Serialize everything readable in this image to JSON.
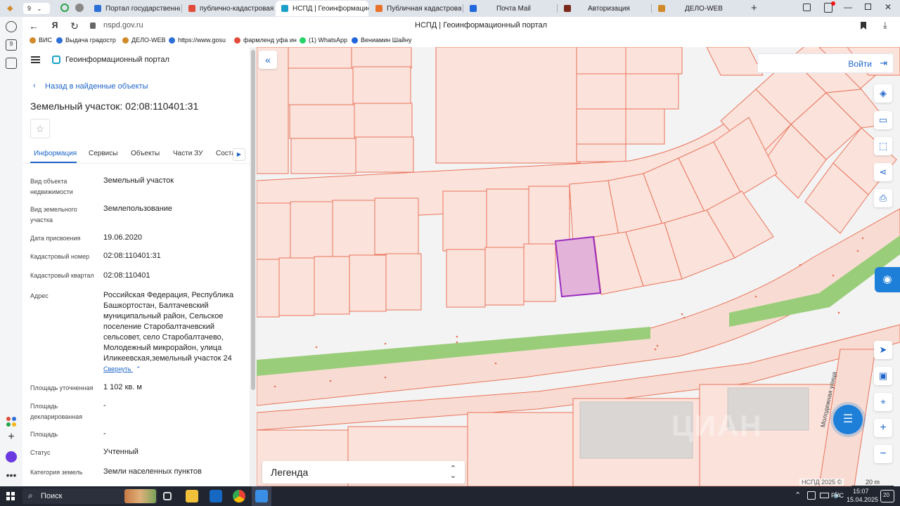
{
  "browser": {
    "tab_count": "9",
    "tabs": [
      {
        "label": "Портал государственных",
        "color": "#2c6fd6"
      },
      {
        "label": "публично-кадастровая ка",
        "color": "#e04b3a"
      },
      {
        "label": "НСПД | Геоинформацио",
        "color": "#1aa0c8"
      },
      {
        "label": "Публичная кадастровая к",
        "color": "#e8722a"
      },
      {
        "label": "Почта Mail",
        "color": "#2266dd"
      },
      {
        "label": "Авторизация",
        "color": "#7a2a1a"
      },
      {
        "label": "ДЕЛО-WEB",
        "color": "#d08a2a"
      }
    ],
    "url": "nspd.gov.ru",
    "page_title": "НСПД | Геоинформационный портал",
    "bookmarks": [
      {
        "label": "ВИС",
        "color": "#d08a2a"
      },
      {
        "label": "Выдача градостр",
        "color": "#2c6fd6"
      },
      {
        "label": "ДЕЛО-WEB",
        "color": "#d08a2a"
      },
      {
        "label": "https://www.gosu",
        "color": "#2c6fd6"
      },
      {
        "label": "фармленд уфа ин",
        "color": "#e04b3a"
      },
      {
        "label": "(1) WhatsApp",
        "color": "#25d366"
      },
      {
        "label": "Вениамин Шайну",
        "color": "#2266dd"
      }
    ]
  },
  "panel": {
    "portal_name": "Геоинформационный портал",
    "back_link": "Назад в найденные объекты",
    "title": "Земельный участок: 02:08:110401:31",
    "tabs": [
      "Информация",
      "Сервисы",
      "Объекты",
      "Части ЗУ",
      "Соста"
    ],
    "fields": [
      {
        "label": "Вид объекта недвижимости",
        "value": "Земельный участок"
      },
      {
        "label": "Вид земельного участка",
        "value": "Землепользование"
      },
      {
        "label": "Дата присвоения",
        "value": "19.06.2020"
      },
      {
        "label": "Кадастровый номер",
        "value": "02:08:110401:31"
      },
      {
        "label": "Кадастровый квартал",
        "value": "02:08:110401"
      },
      {
        "label": "Адрес",
        "value": "Российская Федерация, Республика Башкортостан, Балтачевский муниципальный район, Сельское поселение Старобалтачевский сельсовет, село Старобалтачево, Молодежный микрорайон, улица Иликеевская,земельный участок 24"
      },
      {
        "label": "Площадь уточненная",
        "value": "1 102 кв. м"
      },
      {
        "label": "Площадь декларированная",
        "value": "-"
      },
      {
        "label": "Площадь",
        "value": "-"
      },
      {
        "label": "Статус",
        "value": "Учтенный"
      },
      {
        "label": "Категория земель",
        "value": "Земли населенных пунктов"
      }
    ],
    "collapse_link": "Свернуть"
  },
  "map": {
    "login": "Войти",
    "legend": "Легенда",
    "attribution": "НСПД 2025",
    "scale": "20 m",
    "street_label": "Молодежная улица"
  },
  "taskbar": {
    "search_label": "Поиск",
    "lang": "РУС",
    "time": "15:07",
    "date": "15.04.2025",
    "notification_count": "20"
  }
}
